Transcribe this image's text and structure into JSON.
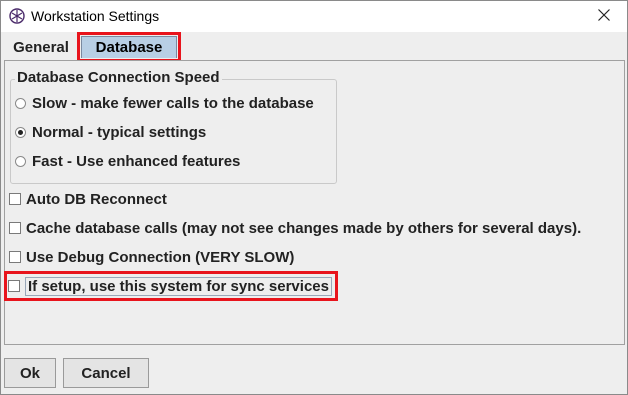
{
  "window": {
    "title": "Workstation Settings",
    "app_icon": "app-logo-icon",
    "close_icon": "close-icon"
  },
  "tabs": [
    {
      "label": "General"
    },
    {
      "label": "Database",
      "selected": true
    }
  ],
  "speed_group": {
    "legend": "Database Connection Speed",
    "options": [
      {
        "label": "Slow - make fewer calls to the database",
        "checked": false
      },
      {
        "label": "Normal - typical settings",
        "checked": true
      },
      {
        "label": "Fast - Use enhanced features",
        "checked": false
      }
    ]
  },
  "checkboxes": [
    {
      "label": "Auto DB Reconnect",
      "checked": false
    },
    {
      "label": "Cache database calls (may not see changes made by others for several days).",
      "checked": false
    },
    {
      "label": "Use Debug Connection (VERY SLOW)",
      "checked": false
    },
    {
      "label": "If setup, use this system for sync services",
      "checked": false
    }
  ],
  "buttons": {
    "ok": "Ok",
    "cancel": "Cancel"
  },
  "colors": {
    "highlight": "#e8141c",
    "selected_tab": "#b8cfe5"
  }
}
